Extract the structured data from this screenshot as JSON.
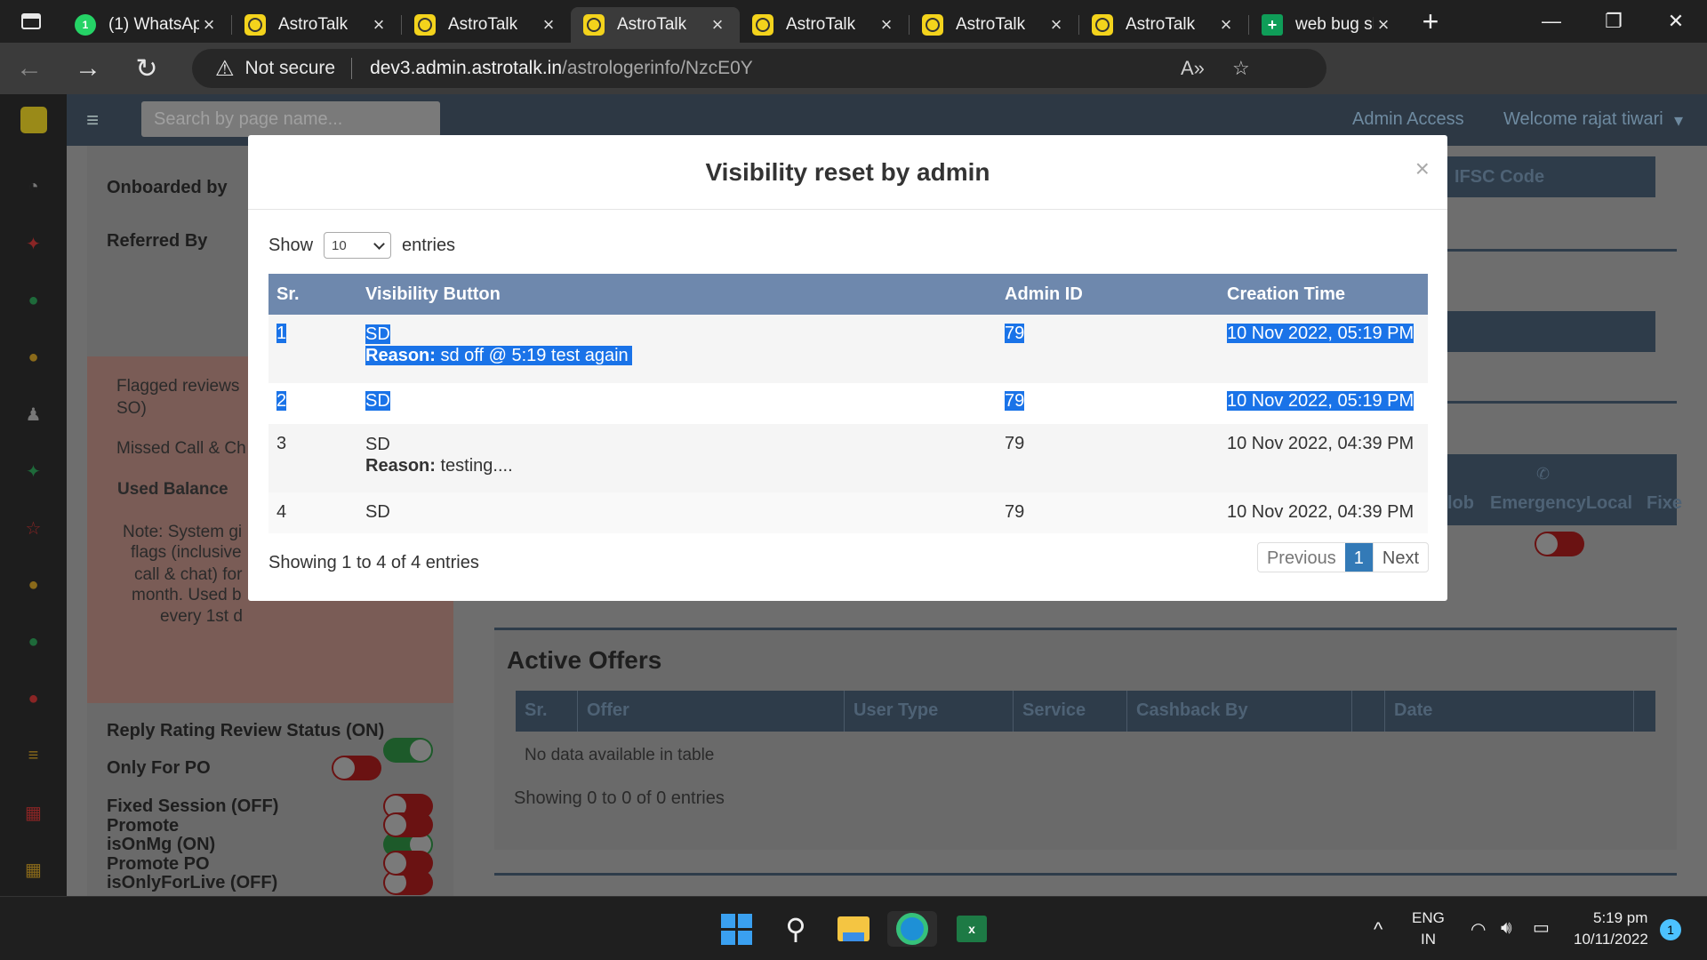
{
  "browser": {
    "tabs": [
      {
        "label": "(1) WhatsAp",
        "icon": "whatsapp-icon",
        "badge": "1"
      },
      {
        "label": "AstroTalk",
        "icon": "astrotalk-icon"
      },
      {
        "label": "AstroTalk",
        "icon": "astrotalk-icon"
      },
      {
        "label": "AstroTalk",
        "icon": "astrotalk-icon",
        "active": true
      },
      {
        "label": "AstroTalk",
        "icon": "astrotalk-icon"
      },
      {
        "label": "AstroTalk",
        "icon": "astrotalk-icon"
      },
      {
        "label": "AstroTalk",
        "icon": "astrotalk-icon"
      },
      {
        "label": "web bug sh",
        "icon": "sheets-icon"
      }
    ],
    "security": "Not secure",
    "url_host": "dev3.admin.astrotalk.in",
    "url_path": "/astrologerinfo/NzcE0Y"
  },
  "page": {
    "search_placeholder": "Search by page name...",
    "admin_access": "Admin Access",
    "welcome": "Welcome rajat tiwari",
    "left": {
      "onboarded_by": "Onboarded by",
      "referred_by": "Referred By",
      "flagged": "Flagged reviews",
      "flagged2": "SO)",
      "missed": "Missed Call & Ch",
      "used_balance": "Used Balance",
      "note1": "Note: System gi",
      "note2": "flags (inclusive",
      "note3": "call & chat) for",
      "note4": "month. Used b",
      "note5": "every 1st d",
      "reply_rating": "Reply Rating Review Status (ON)",
      "only_po": "Only For PO",
      "fixed_session": "Fixed Session (OFF)",
      "is_on_mg": "isOnMg (ON)",
      "is_only_live": "isOnlyForLive (OFF)",
      "promote": "Promote",
      "promote_po": "Promote PO"
    },
    "right": {
      "ifsc": "IFSC Code",
      "lob": "lob",
      "emergency": "EmergencyLocal",
      "fix": "Fixe"
    },
    "offers": {
      "title": "Active Offers",
      "headers": [
        "Sr.",
        "Offer",
        "User Type",
        "Service",
        "Cashback By",
        "",
        "Date"
      ],
      "empty": "No data available in table",
      "info": "Showing 0 to 0 of 0 entries"
    }
  },
  "modal": {
    "title": "Visibility reset by admin",
    "close": "×",
    "show_label": "Show",
    "show_value": "10",
    "entries_label": "entries",
    "headers": {
      "sr": "Sr.",
      "button": "Visibility Button",
      "admin": "Admin ID",
      "time": "Creation Time"
    },
    "rows": [
      {
        "sr": "1",
        "button": "SD",
        "reason_label": "Reason:",
        "reason": "sd off @ 5:19 test again",
        "admin": "79",
        "time": "10 Nov 2022, 05:19 PM",
        "selected": true
      },
      {
        "sr": "2",
        "button": "SD",
        "admin": "79",
        "time": "10 Nov 2022, 05:19 PM",
        "selected": true
      },
      {
        "sr": "3",
        "button": "SD",
        "reason_label": "Reason:",
        "reason": "testing....",
        "admin": "79",
        "time": "10 Nov 2022, 04:39 PM"
      },
      {
        "sr": "4",
        "button": "SD",
        "admin": "79",
        "time": "10 Nov 2022, 04:39 PM"
      }
    ],
    "info": "Showing 1 to 4 of 4 entries",
    "pager": {
      "prev": "Previous",
      "page": "1",
      "next": "Next"
    }
  },
  "taskbar": {
    "lang1": "ENG",
    "lang2": "IN",
    "time": "5:19 pm",
    "date": "10/11/2022",
    "notif": "1"
  }
}
